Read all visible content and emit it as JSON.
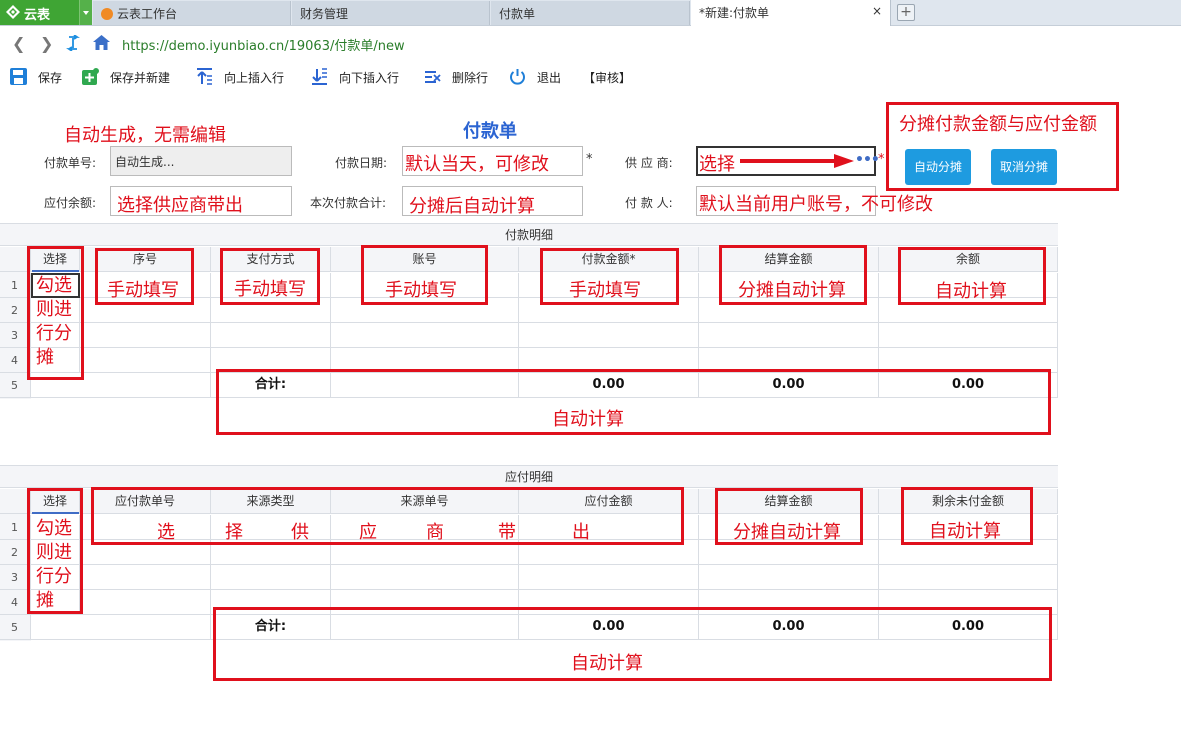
{
  "browser": {
    "logo_label": "云表",
    "tabs": [
      {
        "label": "云表工作台"
      },
      {
        "label": "财务管理"
      },
      {
        "label": "付款单"
      },
      {
        "label": "*新建:付款单",
        "close": "×"
      }
    ],
    "newtab": "+",
    "url": "https://demo.iyunbiao.cn/19063/付款单/new"
  },
  "toolbar": {
    "save": "保存",
    "save_new": "保存并新建",
    "insert_above": "向上插入行",
    "insert_below": "向下插入行",
    "delete_row": "删除行",
    "exit": "退出",
    "audit": "【审核】"
  },
  "form": {
    "title": "付款单",
    "payment_no_label": "付款单号:",
    "payment_no_value": "自动生成...",
    "payment_date_label": "付款日期:",
    "supplier_label": "供 应 商:",
    "payable_balance_label": "应付余额:",
    "this_payment_total_label": "本次付款合计:",
    "payer_label": "付 款 人:",
    "required_mark": "*",
    "supplier_more": "•••",
    "auto_allocate": "自动分摊",
    "cancel_allocate": "取消分摊"
  },
  "annotations": {
    "auto_gen": "自动生成，无需编辑",
    "default_today": "默认当天，可修改",
    "select": "选择",
    "allocate_note": "分摊付款金额与应付金额",
    "select_supplier": "选择供应商带出",
    "auto_after_allocate": "分摊后自动计算",
    "default_user": "默认当前用户账号，不可修改",
    "check_allocate": [
      "勾选",
      "则进",
      "行分",
      "摊"
    ],
    "manual_fill": "手动填写",
    "allocate_auto_calc": "分摊自动计算",
    "auto_calc": "自动计算",
    "choose_supplier_chars": [
      "选",
      "择",
      "供",
      "应",
      "商",
      "带",
      "出"
    ]
  },
  "grid1": {
    "title": "付款明细",
    "headers": [
      "选择",
      "序号",
      "支付方式",
      "账号",
      "付款金额*",
      "结算金额",
      "余额"
    ],
    "rows": [
      "1",
      "2",
      "3",
      "4",
      "5"
    ],
    "sum_label": "合计:",
    "sums": [
      "0.00",
      "0.00",
      "0.00"
    ]
  },
  "grid2": {
    "title": "应付明细",
    "headers": [
      "选择",
      "应付款单号",
      "来源类型",
      "来源单号",
      "应付金额",
      "结算金额",
      "剩余未付金额"
    ],
    "rows": [
      "1",
      "2",
      "3",
      "4",
      "5"
    ],
    "sum_label": "合计:",
    "sums": [
      "0.00",
      "0.00",
      "0.00"
    ]
  },
  "colors": {
    "accent": "#1e9be0",
    "annotation": "#e0101c",
    "title": "#2b64d2",
    "logo": "#3fa534"
  }
}
